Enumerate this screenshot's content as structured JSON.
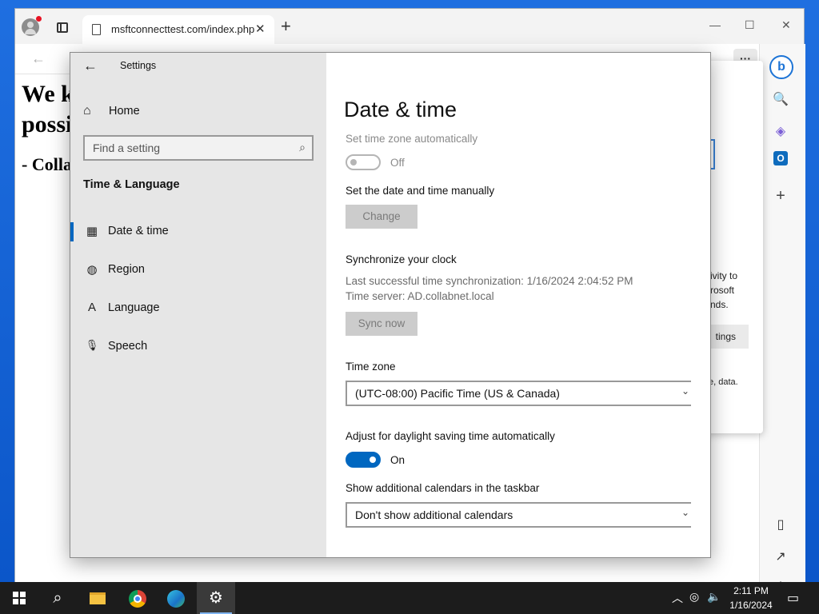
{
  "browser": {
    "tab_title": "msftconnecttest.com/index.php",
    "tab_close": "✕",
    "new_tab": "+",
    "minimize": "—",
    "maximize": "☐",
    "close": "✕",
    "back": "←",
    "more": "···",
    "page_heading": "We k possi",
    "page_sub": "- Colla",
    "popup": {
      "text_lines": "ivity to rosoft nds.",
      "button_label": "tings",
      "text2": "e, data."
    },
    "side_panel": {
      "bing": "b",
      "search": "🔍",
      "copilot": "◈",
      "outlook": "O",
      "add": "+",
      "split": "▯",
      "share": "↗",
      "settings": "⚙"
    }
  },
  "settings": {
    "window_title": "Settings",
    "back": "←",
    "minimize": "—",
    "maximize": "☐",
    "close": "✕",
    "nav": {
      "home": "Home",
      "search_placeholder": "Find a setting",
      "section": "Time & Language",
      "items": [
        {
          "label": "Date & time",
          "icon": "calendar-clock-icon",
          "glyph": "▦"
        },
        {
          "label": "Region",
          "icon": "globe-icon",
          "glyph": "◍"
        },
        {
          "label": "Language",
          "icon": "language-icon",
          "glyph": "A"
        },
        {
          "label": "Speech",
          "icon": "microphone-icon",
          "glyph": "🎙"
        }
      ]
    },
    "page": {
      "title": "Date & time",
      "auto_timezone_label": "Set time zone automatically",
      "auto_timezone_state": "Off",
      "manual_label": "Set the date and time manually",
      "change_button": "Change",
      "sync_heading": "Synchronize your clock",
      "sync_last": "Last successful time synchronization: 1/16/2024 2:04:52 PM",
      "sync_server": "Time server: AD.collabnet.local",
      "sync_button": "Sync now",
      "timezone_label": "Time zone",
      "timezone_value": "(UTC-08:00) Pacific Time (US & Canada)",
      "dst_label": "Adjust for daylight saving time automatically",
      "dst_state": "On",
      "calendars_label": "Show additional calendars in the taskbar",
      "calendars_value": "Don't show additional calendars"
    }
  },
  "taskbar": {
    "time": "2:11 PM",
    "date": "1/16/2024",
    "accent": "#0067c0"
  }
}
